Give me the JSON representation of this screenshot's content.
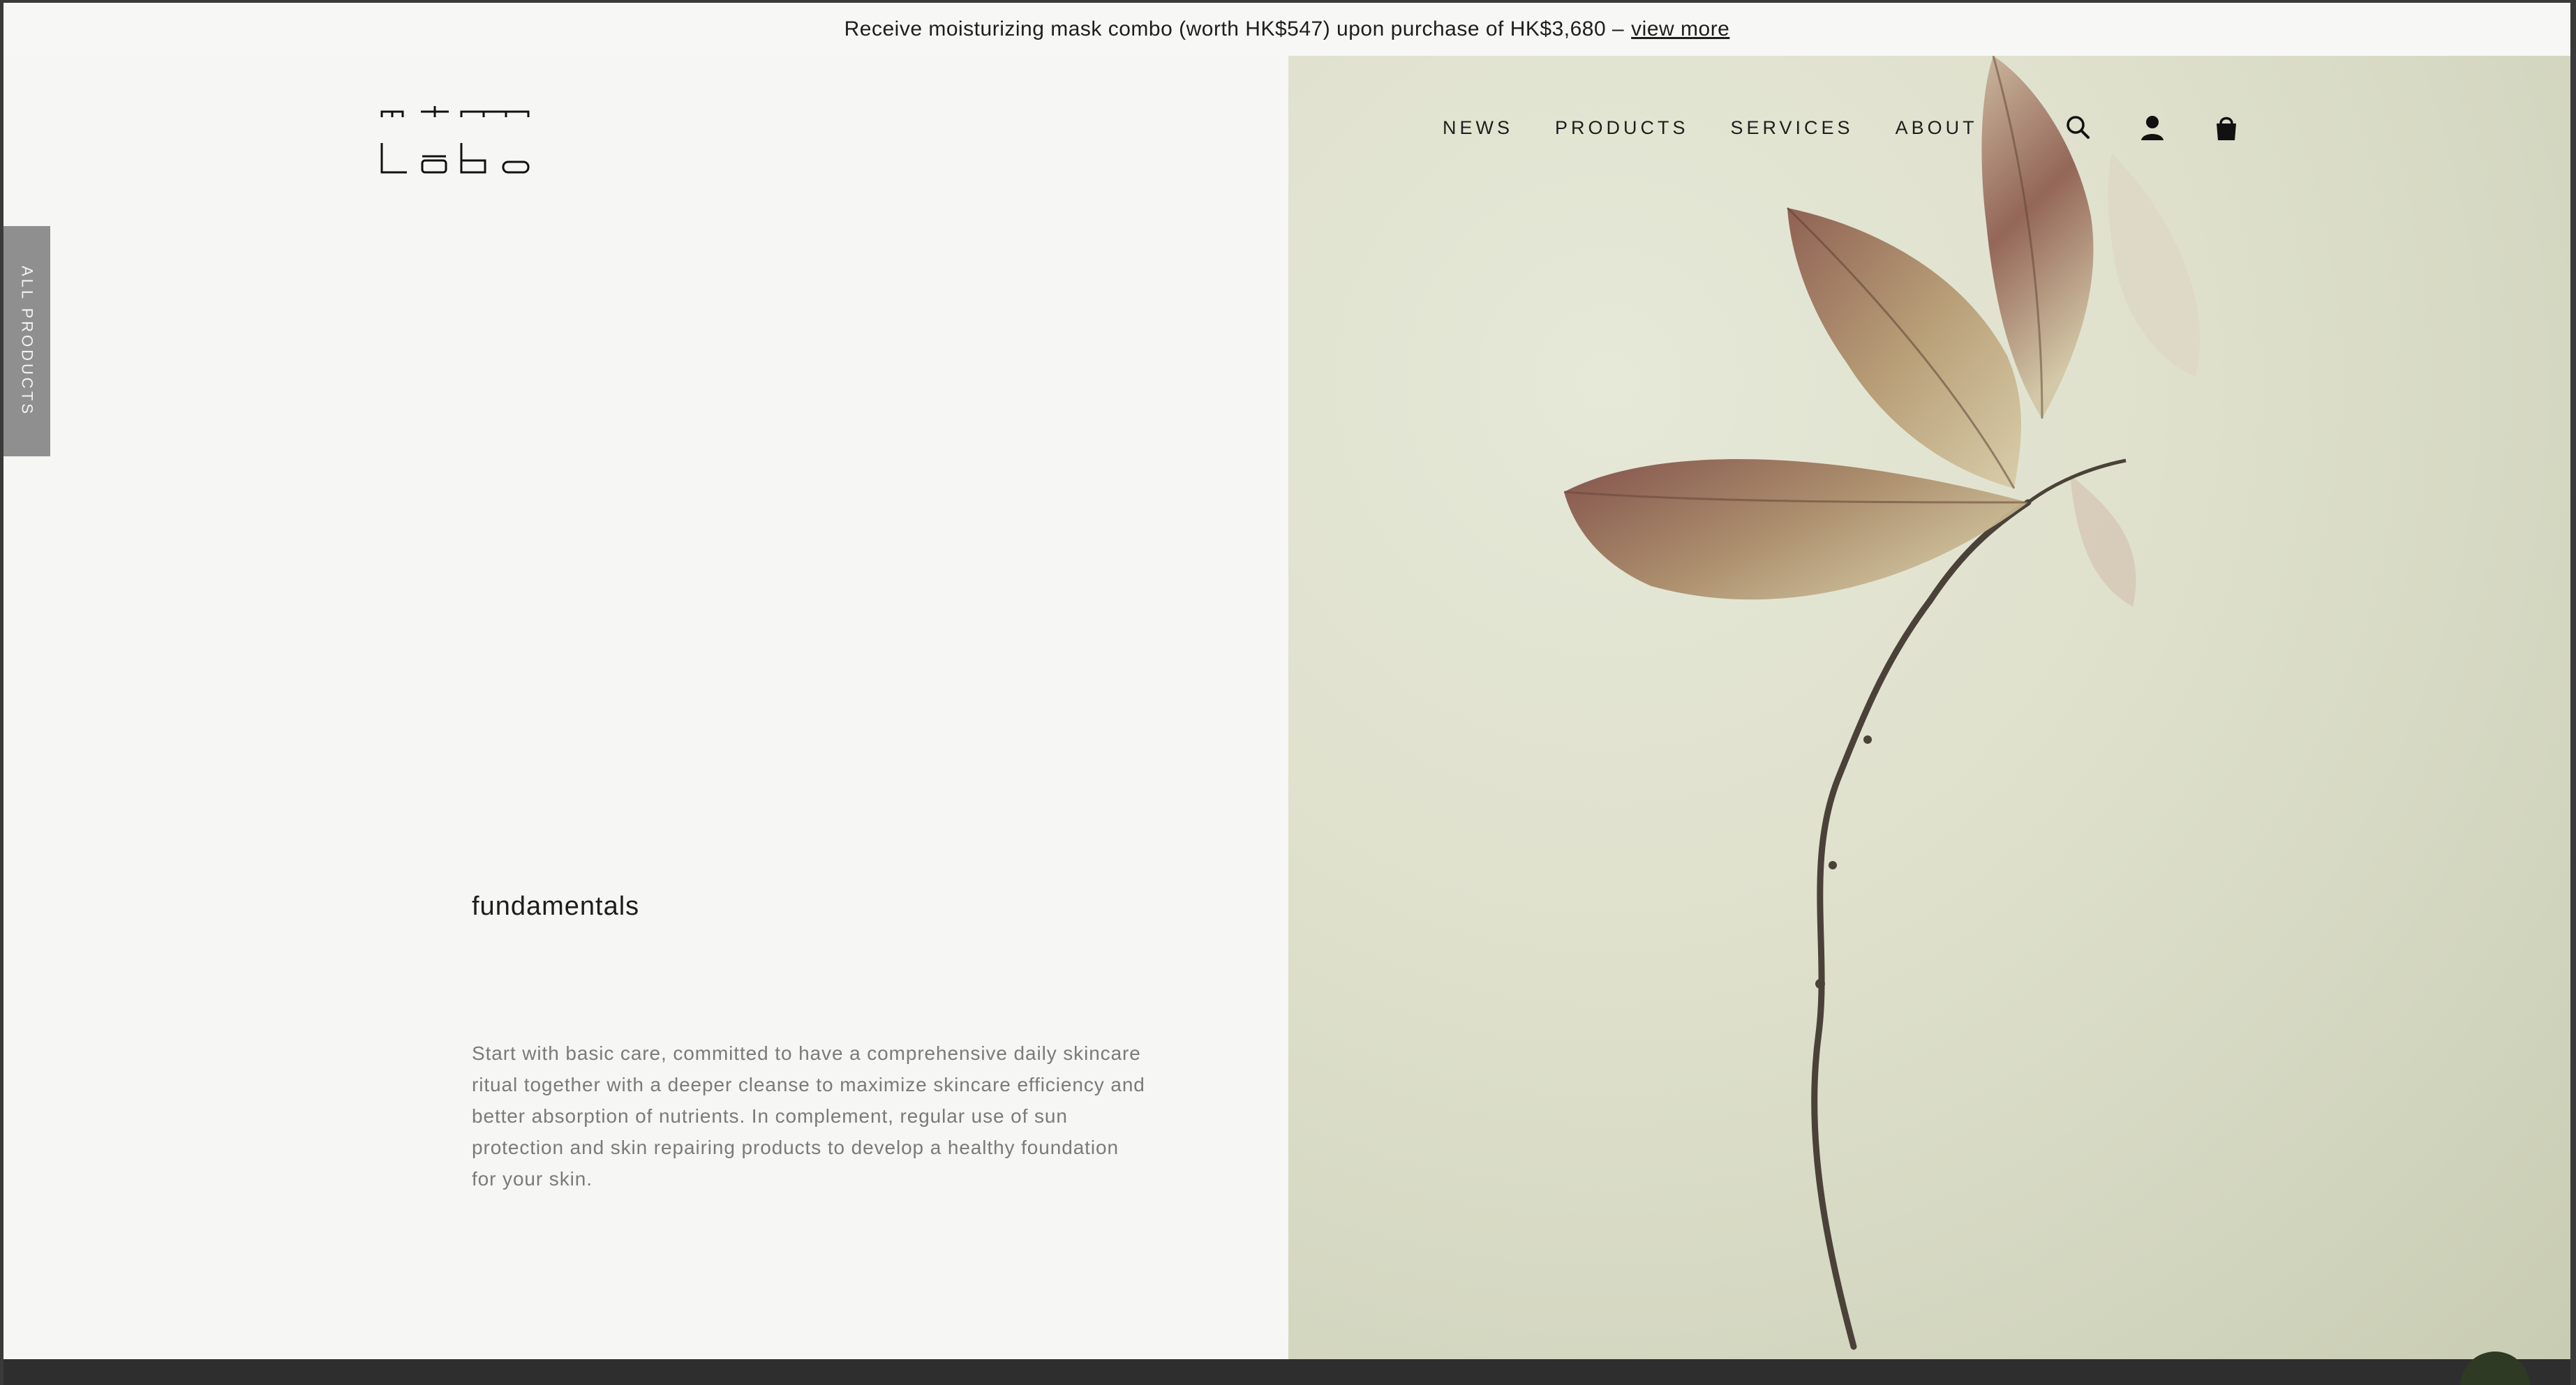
{
  "promo": {
    "text": "Receive moisturizing mask combo (worth HK$547) upon purchase of HK$3,680 –",
    "link_label": "view more"
  },
  "brand": {
    "logo_text": "mt labo"
  },
  "side_tab": {
    "label": "ALL PRODUCTS"
  },
  "nav": {
    "items": [
      {
        "label": "NEWS"
      },
      {
        "label": "PRODUCTS"
      },
      {
        "label": "SERVICES"
      },
      {
        "label": "ABOUT"
      }
    ],
    "icons": [
      "search-icon",
      "account-icon",
      "cart-icon"
    ]
  },
  "section": {
    "title": "fundamentals",
    "description": "Start with basic care, committed to have a comprehensive daily skincare ritual together with a deeper cleanse to maximize skincare efficiency and better absorption of nutrients. In complement, regular use of sun protection and skin repairing products to develop a healthy foundation for your skin."
  },
  "chat": {
    "dots": "•••"
  },
  "colors": {
    "background": "#f6f6f4",
    "hero_bg": "#dfe1cd",
    "side_tab": "#8f8f8f",
    "footer": "#2e2e2e",
    "chat": "#2f3a25"
  }
}
